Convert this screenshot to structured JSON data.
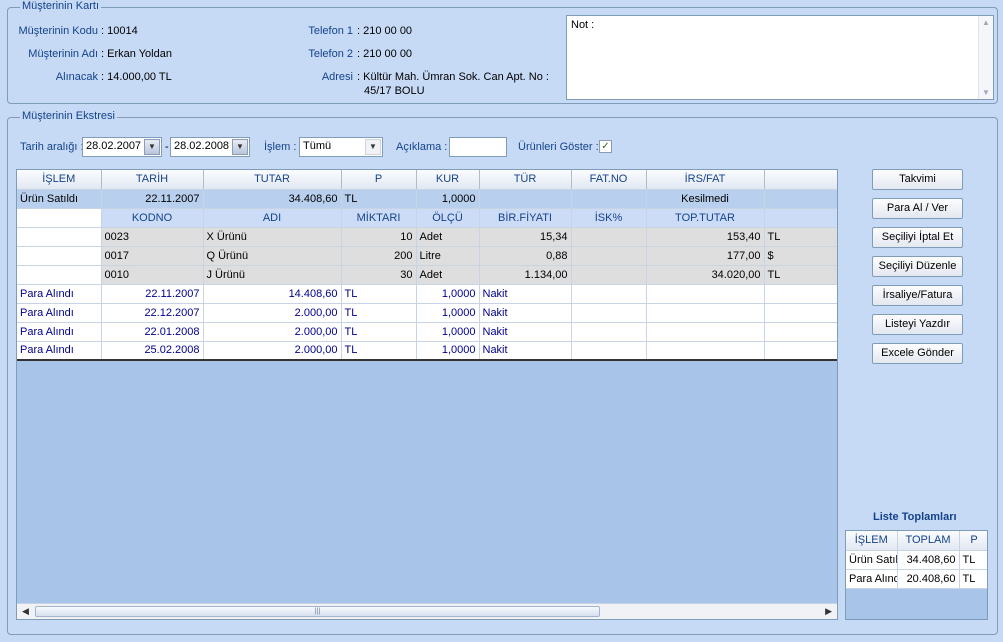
{
  "customer_card": {
    "title": "Müşterinin Kartı",
    "code_label": "Müşterinin Kodu",
    "code": ": 10014",
    "name_label": "Müşterinin Adı",
    "name": ": Erkan Yoldan",
    "receivable_label": "Alınacak",
    "receivable": ": 14.000,00 TL",
    "phone1_label": "Telefon 1",
    "phone1": ": 210 00 00",
    "phone2_label": "Telefon 2",
    "phone2": ": 210 00 00",
    "address_label": "Adresi",
    "address_line1": ": Kültür Mah. Ümran Sok. Can Apt. No :",
    "address_line2": "45/17 BOLU",
    "note_label": "Not :"
  },
  "statement": {
    "title": "Müşterinin Ekstresi",
    "date_range_label": "Tarih aralığı :",
    "date_from": "28.02.2007",
    "date_sep": "-",
    "date_to": "28.02.2008",
    "operation_label": "İşlem :",
    "operation_value": "Tümü",
    "description_label": "Açıklama :",
    "description_value": "",
    "show_products_label": "Ürünleri Göster :",
    "show_products_checked": true
  },
  "grid": {
    "headers": [
      "İŞLEM",
      "TARİH",
      "TUTAR",
      "P",
      "KUR",
      "TÜR",
      "FAT.NO",
      "İRS/FAT",
      ""
    ],
    "sale_row": {
      "islem": "Ürün Satıldı",
      "tarih": "22.11.2007",
      "tutar": "34.408,60",
      "p": "TL",
      "kur": "1,0000",
      "tur": "",
      "fatno": "",
      "irsfat": "Kesilmedi"
    },
    "sub_headers": [
      "KODNO",
      "ADI",
      "MİKTARI",
      "ÖLÇÜ",
      "BİR.FİYATI",
      "İSK%",
      "TOP.TUTAR"
    ],
    "sub_rows": [
      {
        "kodno": "0023",
        "adi": "X Ürünü",
        "miktari": "10",
        "olcu": "Adet",
        "fiyat": "15,34",
        "isk": "",
        "toptutar": "153,40",
        "p": "TL"
      },
      {
        "kodno": "0017",
        "adi": "Q Ürünü",
        "miktari": "200",
        "olcu": "Litre",
        "fiyat": "0,88",
        "isk": "",
        "toptutar": "177,00",
        "p": "$"
      },
      {
        "kodno": "0010",
        "adi": "J Ürünü",
        "miktari": "30",
        "olcu": "Adet",
        "fiyat": "1.134,00",
        "isk": "",
        "toptutar": "34.020,00",
        "p": "TL"
      }
    ],
    "payments": [
      {
        "islem": "Para Alındı",
        "tarih": "22.11.2007",
        "tutar": "14.408,60",
        "p": "TL",
        "kur": "1,0000",
        "tur": "Nakit"
      },
      {
        "islem": "Para Alındı",
        "tarih": "22.12.2007",
        "tutar": "2.000,00",
        "p": "TL",
        "kur": "1,0000",
        "tur": "Nakit"
      },
      {
        "islem": "Para Alındı",
        "tarih": "22.01.2008",
        "tutar": "2.000,00",
        "p": "TL",
        "kur": "1,0000",
        "tur": "Nakit"
      },
      {
        "islem": "Para Alındı",
        "tarih": "25.02.2008",
        "tutar": "2.000,00",
        "p": "TL",
        "kur": "1,0000",
        "tur": "Nakit"
      }
    ]
  },
  "buttons": {
    "calendar": "Takvimi",
    "money": "Para Al / Ver",
    "cancel_selected": "Seçiliyi İptal Et",
    "edit_selected": "Seçiliyi Düzenle",
    "invoice": "İrsaliye/Fatura",
    "print": "Listeyi Yazdır",
    "excel": "Excele Gönder"
  },
  "totals": {
    "title": "Liste Toplamları",
    "headers": [
      "İŞLEM",
      "TOPLAM",
      "P"
    ],
    "rows": [
      {
        "islem": "Ürün Satıldı",
        "toplam": "34.408,60",
        "p": "TL"
      },
      {
        "islem": "Para Alındı",
        "toplam": "20.408,60",
        "p": "TL"
      }
    ]
  }
}
